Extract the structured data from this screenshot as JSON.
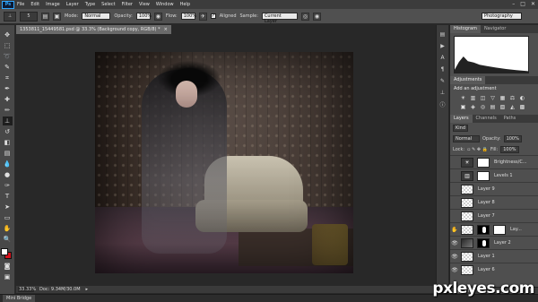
{
  "app": {
    "logo": "Ps"
  },
  "menu": [
    "File",
    "Edit",
    "Image",
    "Layer",
    "Type",
    "Select",
    "Filter",
    "View",
    "Window",
    "Help"
  ],
  "window_controls": {
    "minimize": "–",
    "maximize": "□",
    "close": "✕"
  },
  "options": {
    "brush_size": "5",
    "mode_label": "Mode:",
    "mode_value": "Normal",
    "opacity_label": "Opacity:",
    "opacity_value": "100%",
    "flow_label": "Flow:",
    "flow_value": "100%",
    "aligned_label": "Aligned",
    "sample_label": "Sample:",
    "sample_value": "Current Layer",
    "workspace": "Photography"
  },
  "document": {
    "tab_title": "1353811_15449581.psd @ 33.3% (Background copy, RGB/8) *",
    "tab_close": "×"
  },
  "status": {
    "zoom": "33.33%",
    "doc_info": "Doc: 9.34M/30.0M"
  },
  "minibridge": {
    "label": "Mini Bridge"
  },
  "panels": {
    "top_tabs": [
      "Histogram",
      "Navigator"
    ],
    "adjustments_tabs": [
      "Adjustments"
    ],
    "adjustments_title": "Add an adjustment",
    "adjustment_icons": [
      "☀",
      "▥",
      "◫",
      "▽",
      "▦",
      "⚖",
      "◐",
      "▣",
      "◈",
      "◎",
      "▤",
      "▧",
      "◭",
      "▩"
    ],
    "layers_tabs": [
      "Layers",
      "Channels",
      "Paths"
    ],
    "kind_label": "Kind",
    "blend_mode": "Normal",
    "opacity_label": "Opacity:",
    "opacity_value": "100%",
    "lock_label": "Lock:",
    "fill_label": "Fill:",
    "fill_value": "100%",
    "layers": [
      {
        "name": "Brightness/C...",
        "visible": false,
        "thumb": "adj",
        "icon": "☀"
      },
      {
        "name": "Levels 1",
        "visible": false,
        "thumb": "adj",
        "icon": "▥"
      },
      {
        "name": "Layer 9",
        "visible": false,
        "thumb": "checker",
        "icon": ""
      },
      {
        "name": "Layer 8",
        "visible": false,
        "thumb": "checker",
        "icon": ""
      },
      {
        "name": "Layer 7",
        "visible": false,
        "thumb": "checker",
        "icon": ""
      },
      {
        "name": "Lay...",
        "visible": true,
        "thumb": "mask",
        "icon": "",
        "selected": false
      },
      {
        "name": "Layer 2",
        "visible": true,
        "thumb": "dark",
        "icon": ""
      },
      {
        "name": "Layer 1",
        "visible": true,
        "thumb": "checker",
        "icon": ""
      },
      {
        "name": "Layer 6",
        "visible": true,
        "thumb": "checker",
        "icon": ""
      }
    ],
    "footer_icons": [
      "⛓",
      "fx",
      "◧",
      "◐",
      "▭",
      "▢",
      "🗑"
    ]
  },
  "watermark": "pxleyes.com"
}
